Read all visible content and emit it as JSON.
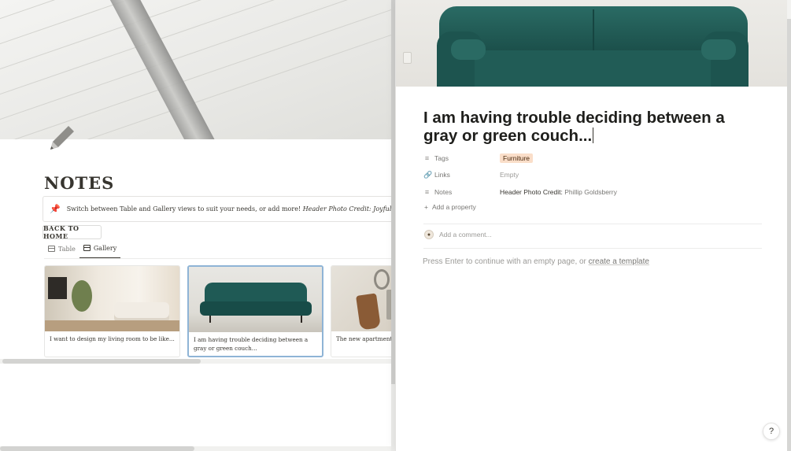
{
  "background_page": {
    "title": "NOTES",
    "callout": {
      "pin_icon": "pushpin-icon",
      "text": "Switch between Table and Gallery views to suit your needs, or add more!",
      "credit_label": "Header Photo Credit:",
      "credit_name": "Joyful"
    },
    "back_button": "BACK TO HOME",
    "views": [
      {
        "label": "Table",
        "icon": "table-icon"
      },
      {
        "label": "Gallery",
        "icon": "gallery-icon",
        "active": true
      }
    ],
    "cards": [
      {
        "caption": "I want to design my living room to be like..."
      },
      {
        "caption": "I am having trouble deciding between a gray or green couch..."
      },
      {
        "caption": "The new apartment is great for..."
      }
    ]
  },
  "peek": {
    "title": "I am having trouble deciding between a gray or green couch...",
    "properties": {
      "tags": {
        "label": "Tags",
        "value": "Furniture",
        "tag_color": "#fadec9"
      },
      "links": {
        "label": "Links",
        "value": "Empty"
      },
      "notes": {
        "label": "Notes",
        "value_prefix": "Header Photo Credit:",
        "value_name": "Phillip Goldsberry"
      }
    },
    "add_property": "Add a property",
    "add_comment": "Add a comment...",
    "empty_hint": "Press Enter to continue with an empty page, or",
    "template_link": "create a template"
  },
  "help": "?"
}
